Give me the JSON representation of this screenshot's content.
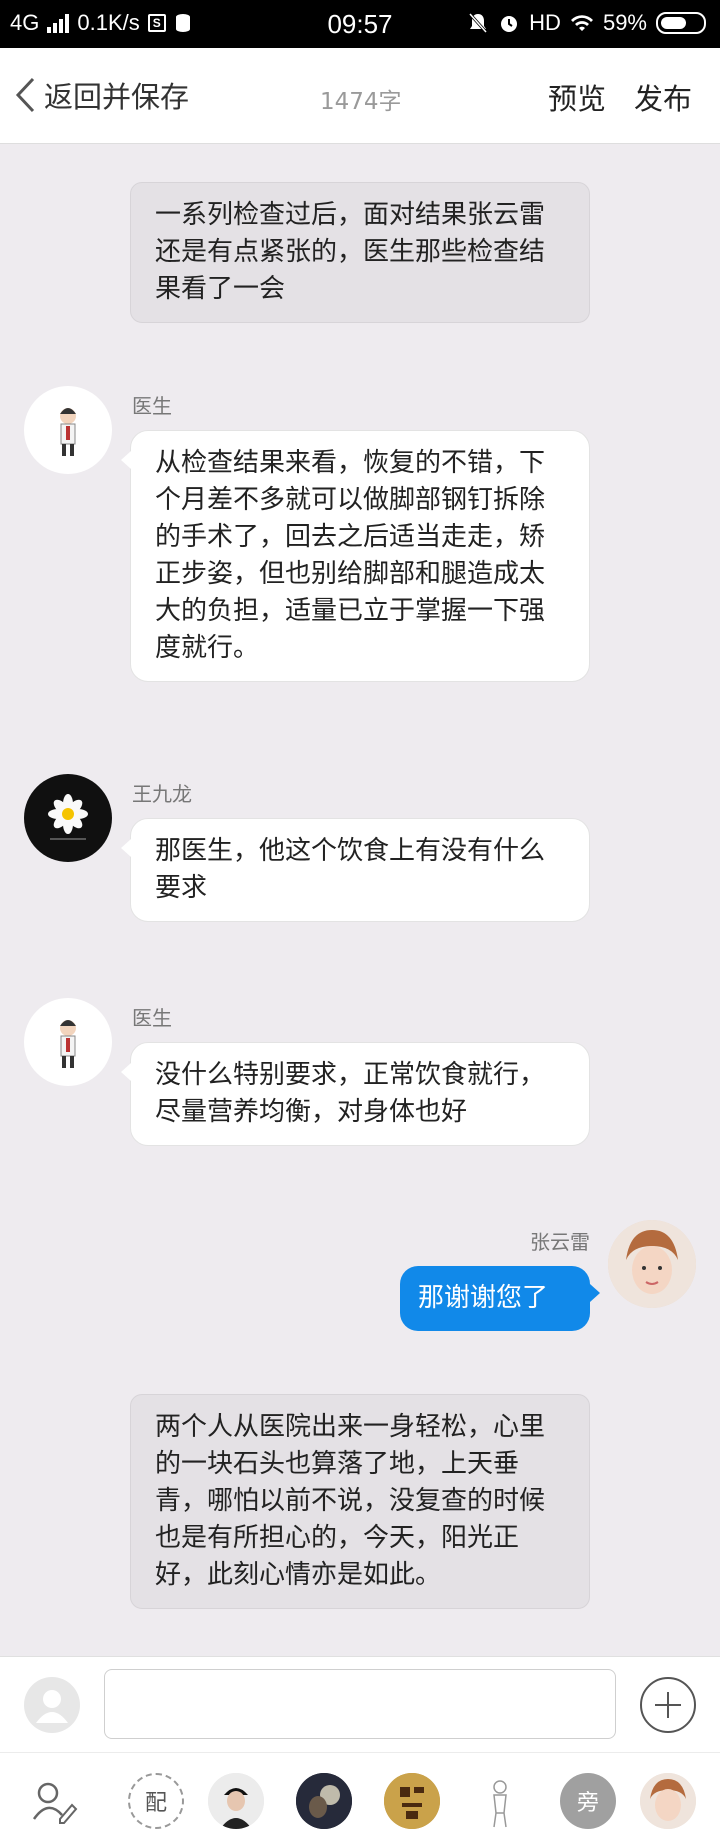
{
  "status_bar": {
    "network": "4G",
    "speed": "0.1K/s",
    "time": "09:57",
    "hd": "HD",
    "battery": "59%",
    "battery_level": 0.59
  },
  "header": {
    "back_label": "返回并保存",
    "word_count": "1474字",
    "preview_label": "预览",
    "publish_label": "发布"
  },
  "messages": [
    {
      "type": "narration",
      "text": "一系列检查过后，面对结果张云雷还是有点紧张的，医生那些检查结果看了一会"
    },
    {
      "type": "received",
      "sender": "医生",
      "avatar": "doctor-avatar",
      "text": "从检查结果来看，恢复的不错，下个月差不多就可以做脚部钢钉拆除的手术了，回去之后适当走走，矫正步姿，但也别给脚部和腿造成太大的负担，适量已立于掌握一下强度就行。"
    },
    {
      "type": "received",
      "sender": "王九龙",
      "avatar": "daisy-avatar",
      "text": "那医生，他这个饮食上有没有什么要求"
    },
    {
      "type": "received",
      "sender": "医生",
      "avatar": "doctor-avatar",
      "text": "没什么特别要求，正常饮食就行，尽量营养均衡，对身体也好"
    },
    {
      "type": "sent",
      "sender": "张云雷",
      "avatar": "user-avatar",
      "text": "那谢谢您了"
    },
    {
      "type": "narration",
      "text": "两个人从医院出来一身轻松，心里的一块石头也算落了地，上天垂青，哪怕以前不说，没复查的时候也是有所担心的，今天，阳光正好，此刻心情亦是如此。"
    }
  ],
  "input_bar": {
    "placeholder": ""
  },
  "character_bar": {
    "items": [
      {
        "name": "edit-character-icon"
      },
      {
        "name": "dub",
        "label": "配"
      },
      {
        "name": "character-1"
      },
      {
        "name": "character-2"
      },
      {
        "name": "character-3"
      },
      {
        "name": "character-4"
      },
      {
        "name": "narrator",
        "label": "旁"
      },
      {
        "name": "character-6"
      }
    ]
  },
  "colors": {
    "background": "#eeebef",
    "sent_bubble": "#1189e9",
    "narration_bubble": "#e4e1e5"
  }
}
